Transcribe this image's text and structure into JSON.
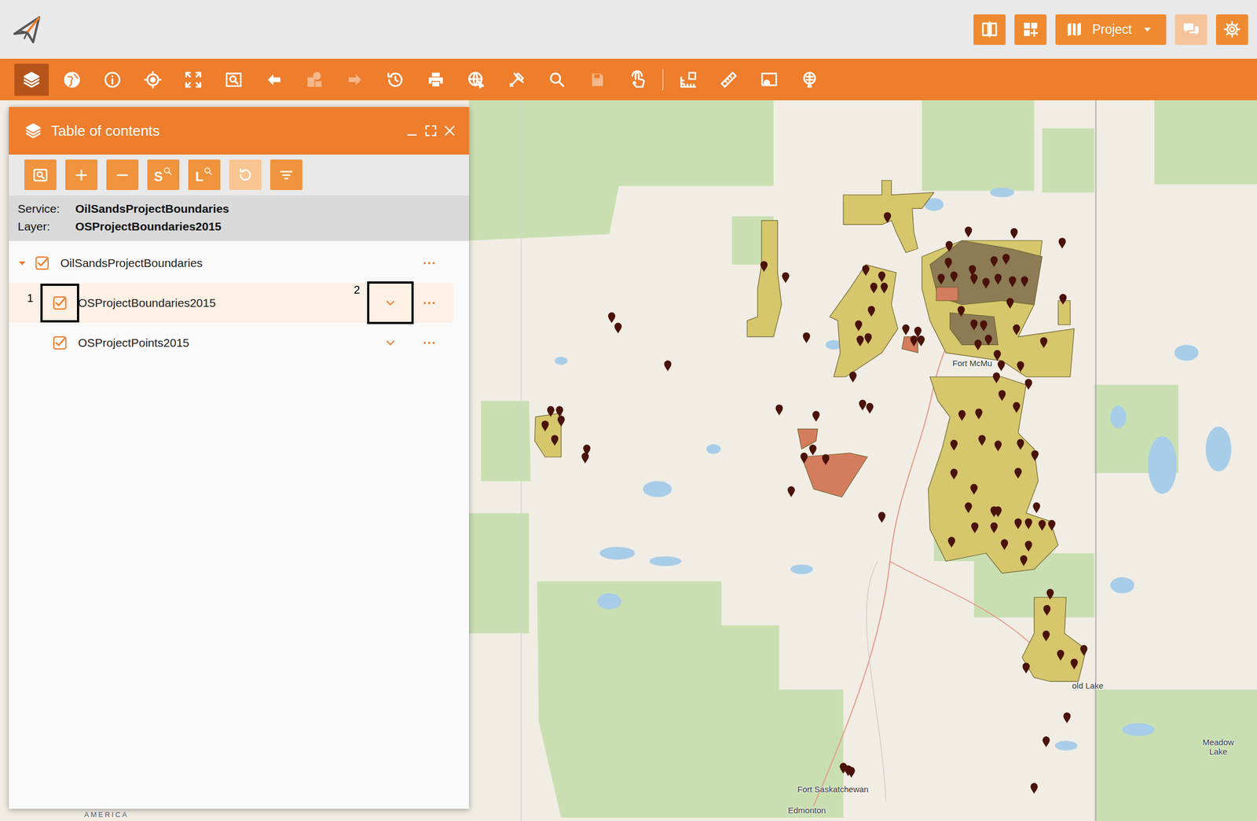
{
  "header": {
    "buttons": [
      {
        "kind": "icon",
        "disabled": false
      },
      {
        "kind": "icon",
        "disabled": false
      },
      {
        "kind": "menu",
        "label": "Project",
        "disabled": false
      },
      {
        "kind": "icon",
        "disabled": true
      },
      {
        "kind": "icon",
        "disabled": false
      }
    ]
  },
  "toolbar": {
    "tools": [
      {
        "active": true,
        "disabled": false
      },
      {
        "active": false,
        "disabled": false
      },
      {
        "active": false,
        "disabled": false
      },
      {
        "active": false,
        "disabled": false
      },
      {
        "active": false,
        "disabled": false
      },
      {
        "active": false,
        "disabled": false
      },
      {
        "active": false,
        "disabled": false
      },
      {
        "active": false,
        "disabled": true
      },
      {
        "active": false,
        "disabled": true
      },
      {
        "active": false,
        "disabled": false
      },
      {
        "active": false,
        "disabled": false
      },
      {
        "active": false,
        "disabled": false
      },
      {
        "active": false,
        "disabled": false
      },
      {
        "active": false,
        "disabled": false
      },
      {
        "active": false,
        "disabled": true
      },
      {
        "active": false,
        "disabled": false
      },
      {
        "active": false,
        "disabled": false
      },
      {
        "active": false,
        "disabled": false
      },
      {
        "active": false,
        "disabled": false
      },
      {
        "active": false,
        "disabled": false
      }
    ]
  },
  "toc": {
    "title": "Table of contents",
    "tools": [
      {
        "disabled": false
      },
      {
        "disabled": false
      },
      {
        "disabled": false
      },
      {
        "disabled": false,
        "label": "S"
      },
      {
        "disabled": false,
        "label": "L"
      },
      {
        "disabled": true
      },
      {
        "disabled": false
      }
    ],
    "info": [
      {
        "label": "Service:",
        "value": "OilSandsProjectBoundaries"
      },
      {
        "label": "Layer:",
        "value": "OSProjectBoundaries2015"
      }
    ],
    "tree": [
      {
        "label": "OilSandsProjectBoundaries",
        "kind": "group",
        "checked": true,
        "expanded": true,
        "selected": false,
        "callouts": []
      },
      {
        "label": "OSProjectBoundaries2015",
        "kind": "layer",
        "checked": true,
        "expanded": false,
        "selected": true,
        "callouts": [
          {
            "label": "1",
            "kind": "checkbox"
          },
          {
            "label": "2",
            "kind": "expand"
          }
        ]
      },
      {
        "label": "OSProjectPoints2015",
        "kind": "layer",
        "checked": true,
        "expanded": false,
        "selected": false,
        "callouts": []
      }
    ]
  },
  "map": {
    "labels": [
      {
        "text": "Fort McMu"
      },
      {
        "text": "old Lake"
      },
      {
        "text": "Fort Saskatchewan"
      },
      {
        "text": "Edmonton"
      },
      {
        "text": "Meadow Lake"
      },
      {
        "text": "AMERICA"
      }
    ]
  }
}
